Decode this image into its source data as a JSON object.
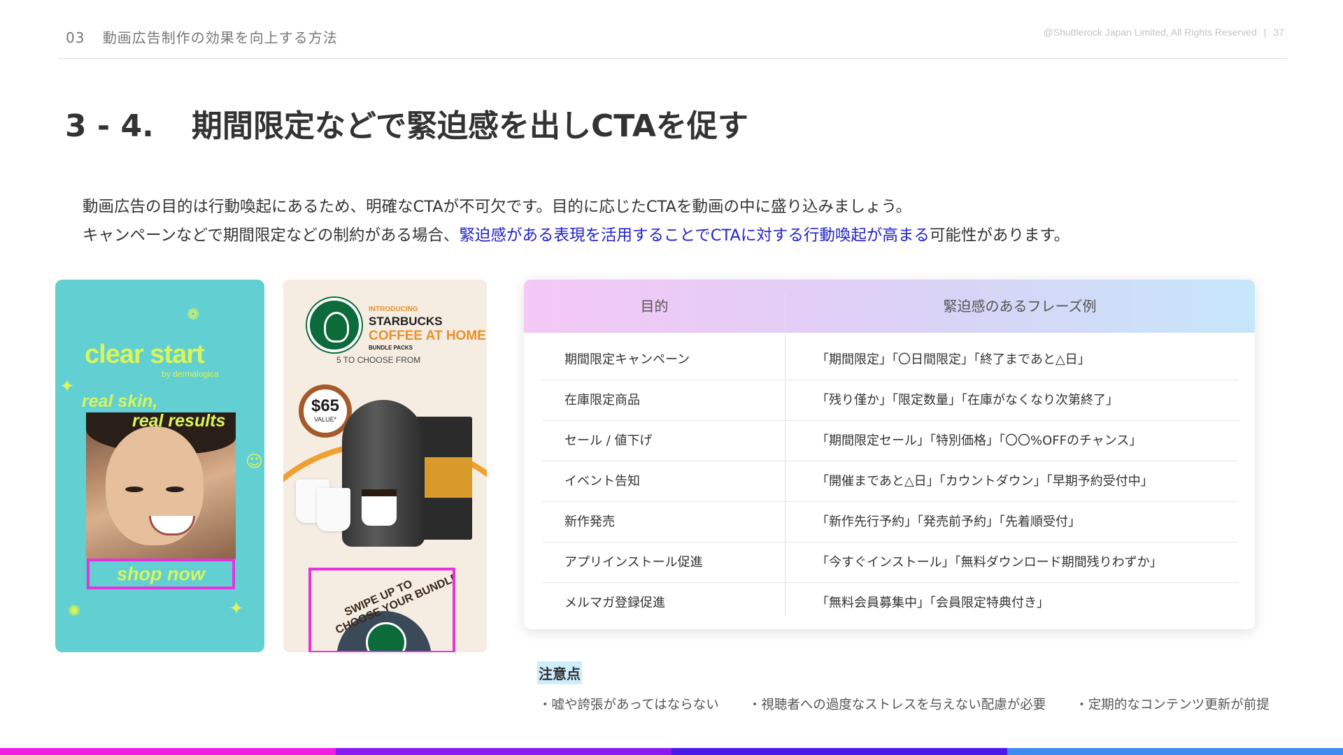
{
  "header": {
    "section_number": "03",
    "section_title": "動画広告制作の効果を向上する方法",
    "copyright": "@Shuttlerock Japan Limited, All Rights Reserved",
    "separator": "|",
    "page_number": "37"
  },
  "title": {
    "number": "3 - 4.",
    "text": "期間限定などで緊迫感を出しCTAを促す"
  },
  "intro": {
    "line1": "動画広告の目的は行動喚起にあるため、明確なCTAが不可欠です。目的に応じたCTAを動画の中に盛り込みましょう。",
    "line2_pre": "キャンペーンなどで期間限定などの制約がある場合、",
    "line2_highlight": "緊迫感がある表現を活用することでCTAに対する行動喚起が高まる",
    "line2_post": "可能性があります。"
  },
  "ad_clearstart": {
    "brand": "clear start",
    "by": "by dermalogica",
    "tagline1": "real skin,",
    "tagline2": "real results",
    "cta": "shop now"
  },
  "ad_starbucks": {
    "introducing": "INTRODUCING",
    "brand": "STARBUCKS",
    "product": "COFFEE AT HOME",
    "bundle": "BUNDLE PACKS",
    "choose": "5 TO CHOOSE FROM",
    "price": "$65",
    "price_note": "VALUE*",
    "cta_line1": "SWIPE UP TO",
    "cta_line2": "CHOOSE YOUR BUNDLE"
  },
  "table": {
    "headers": [
      "目的",
      "緊迫感のあるフレーズ例"
    ],
    "rows": [
      [
        "期間限定キャンペーン",
        "「期間限定」「〇日間限定」「終了まであと△日」"
      ],
      [
        "在庫限定商品",
        "「残り僅か」「限定数量」「在庫がなくなり次第終了」"
      ],
      [
        "セール / 値下げ",
        "「期間限定セール」「特別価格」「〇〇%OFFのチャンス」"
      ],
      [
        "イベント告知",
        "「開催まであと△日」「カウントダウン」「早期予約受付中」"
      ],
      [
        "新作発売",
        "「新作先行予約」「発売前予約」「先着順受付」"
      ],
      [
        "アプリインストール促進",
        "「今すぐインストール」「無料ダウンロード期間残りわずか」"
      ],
      [
        "メルマガ登録促進",
        "「無料会員募集中」「会員限定特典付き」"
      ]
    ]
  },
  "caution": {
    "title": "注意点",
    "items": [
      "・嘘や誇張があってはならない",
      "・視聴者への過度なストレスを与えない配慮が必要",
      "・定期的なコンテンツ更新が前提"
    ]
  },
  "colors": {
    "highlight_text": "#2323c8",
    "ad1_background": "#62cfd3",
    "ad1_text": "#d8f55a",
    "cta_outline": "#e533dd",
    "bottom_bar": [
      "#f01ee0",
      "#8a1af0",
      "#4a1ae8",
      "#3f8cf0"
    ]
  }
}
